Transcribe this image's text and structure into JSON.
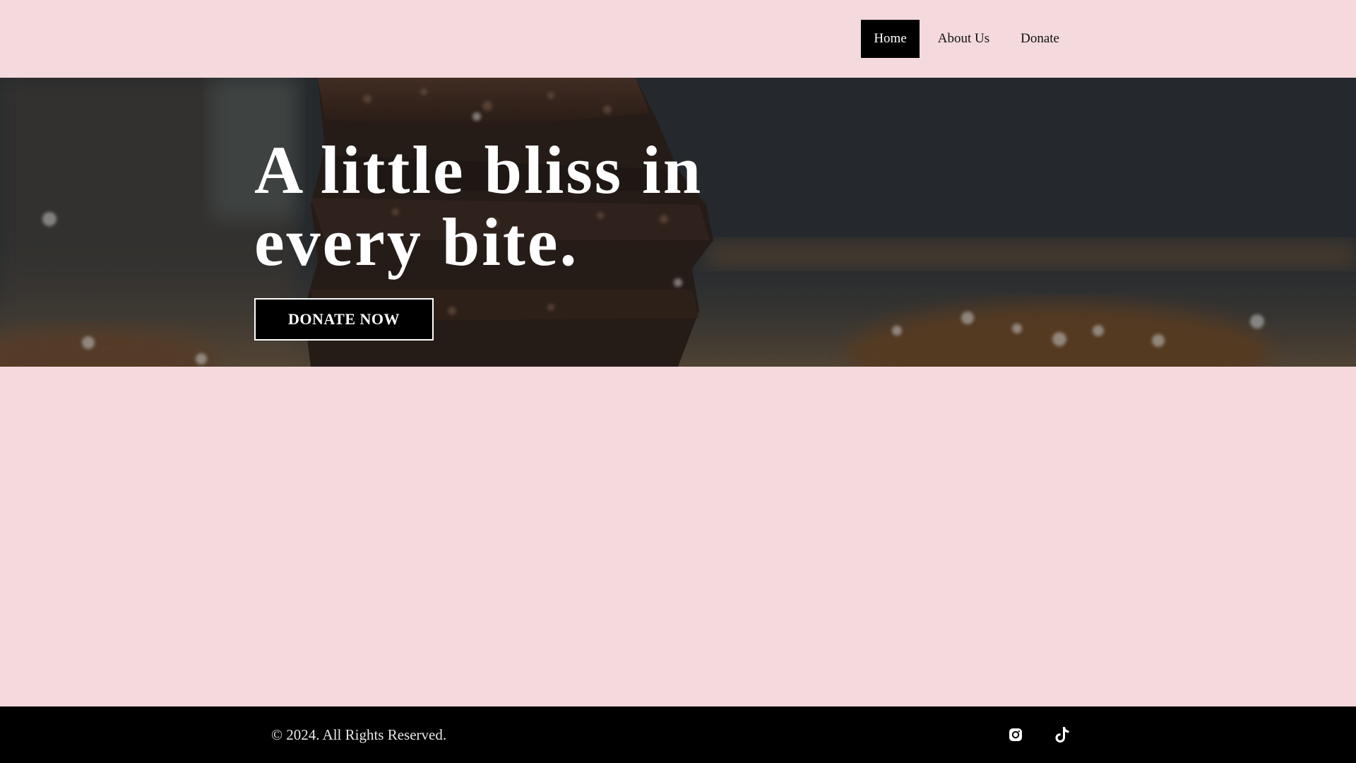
{
  "nav": {
    "items": [
      {
        "label": "Home",
        "active": true
      },
      {
        "label": "About Us",
        "active": false
      },
      {
        "label": "Donate",
        "active": false
      }
    ]
  },
  "hero": {
    "title_line1": "A little bliss in",
    "title_line2": "every bite.",
    "cta_label": "DONATE NOW",
    "background_image": "stacked-brownies-photo"
  },
  "footer": {
    "copyright": "© 2024. All Rights Reserved.",
    "social": [
      {
        "icon": "instagram-icon"
      },
      {
        "icon": "tiktok-icon"
      }
    ]
  },
  "colors": {
    "page_background": "#f4d9dd",
    "footer_background": "#000000",
    "active_nav_background": "#000000",
    "hero_text": "#ffffff"
  }
}
